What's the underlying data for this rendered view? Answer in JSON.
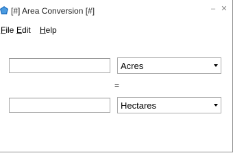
{
  "window": {
    "title": "[#] Area Conversion [#]",
    "minimize_glyph": "–",
    "close_glyph": "✕"
  },
  "menu": {
    "file": {
      "mnemonic": "F",
      "rest": "ile"
    },
    "edit": {
      "mnemonic": "E",
      "rest": "dit"
    },
    "help": {
      "mnemonic": "H",
      "rest": "elp"
    }
  },
  "converter": {
    "from_value": "",
    "to_value": "",
    "from_unit": "Acres",
    "to_unit": "Hectares",
    "equals": "="
  },
  "icons": {
    "app": "app-window-icon",
    "dropdown": "chevron-down-icon"
  }
}
